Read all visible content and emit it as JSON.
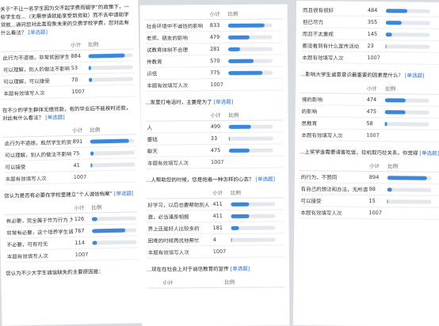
{
  "page1": {
    "sections": [
      {
        "question": "关于“不让一名学生因为交不起学费而辍学”的政策下，一些学生在...（无需申请就能享受到资助）而不去申请助学贷款...请问您对此类现象未来的交费学校学费，您对此有什么看法？",
        "tag": "[单选题]",
        "count_header": "小计",
        "ratio_header": "比例",
        "rows": [
          {
            "label": "此行为不道德，非常贫困学生享受资助，...资助不够的话需要自己的努力",
            "count": "884",
            "pct": 0.83
          },
          {
            "label": "可以理解，别人的做法不影响自己的事",
            "count": "53",
            "pct": 0.05
          },
          {
            "label": "可以理解，可以接受",
            "count": "70",
            "pct": 0.07
          }
        ],
        "total_label": "本题有效填写人次",
        "total": "1007"
      },
      {
        "question": "在不少的学生群体无偿贷款，有的毕业后不能按时还款，对此有什么看法？",
        "tag": "[单选题]",
        "count_header": "小计",
        "ratio_header": "比例",
        "rows": [
          {
            "label": "此行为不道德，既然学生的资源，要不就应该 不能让他违反",
            "count": "891",
            "pct": 0.88
          },
          {
            "label": "可以理解，别人的做法不影响自己的事",
            "count": "75",
            "pct": 0.07
          },
          {
            "label": "可以接受",
            "count": "41",
            "pct": 0.04
          }
        ],
        "total_label": "本题有效填写人次",
        "total": "1007"
      },
      {
        "question": "您认为是否有必要在学校里建立“个人诚信档案”",
        "tag": "[单选题]",
        "count_header": "小计",
        "ratio_header": "比例",
        "rows": [
          {
            "label": "有必要，完全属于作为行为 为，培养学生诚信意识的需要",
            "count": "126",
            "pct": 0.13
          },
          {
            "label": "非常有必要，这个培养学生诚信意识及其 对",
            "count": "767",
            "pct": 0.76
          },
          {
            "label": "不必要，可有可无",
            "count": "114",
            "pct": 0.11
          }
        ],
        "total_label": "本题有效填写人次",
        "total": "1007"
      }
    ],
    "bottom_question": "您认为不少大学生诚信缺失的主要原因是："
  },
  "page2": {
    "top_table": {
      "count_header": "小计",
      "ratio_header": "比例",
      "rows": [
        {
          "label": "社会环境中不诚信的影响",
          "count": "833",
          "pct": 0.83
        },
        {
          "label": "老师、朋友的影响",
          "count": "479",
          "pct": 0.48
        },
        {
          "label": "试教育体制不合理",
          "count": "281",
          "pct": 0.28
        },
        {
          "label": "传教育",
          "count": "570",
          "pct": 0.57
        },
        {
          "label": "识低",
          "count": "775",
          "pct": 0.77
        }
      ],
      "total_label": "本题有效填写人次",
      "total": "1007"
    },
    "sections": [
      {
        "question": "...家里打电话时，主要是为了",
        "tag": "[单选题]",
        "count_header": "小计",
        "ratio_header": "比例",
        "rows": [
          {
            "label": "人",
            "count": "499",
            "pct": 0.5
          },
          {
            "label": "要钱",
            "count": "33",
            "pct": 0.03
          },
          {
            "label": "聊天",
            "count": "475",
            "pct": 0.47
          }
        ],
        "total_label": "本题有效填写人次",
        "total": "1007"
      },
      {
        "question": "...人帮助您的时候，您是抱着一种怎样的心态？",
        "tag": "[单选题]",
        "count_header": "小计",
        "ratio_header": "比例",
        "rows": [
          {
            "label": "好学习，以后也要帮助别人",
            "count": "411",
            "pct": 0.41
          },
          {
            "label": "激，必当涌泉相报",
            "count": "411",
            "pct": 0.41
          },
          {
            "label": "界上还是好人比较多的",
            "count": "181",
            "pct": 0.18
          },
          {
            "label": "困难的时候再找他帮忙",
            "count": "4",
            "pct": 0.004
          }
        ],
        "total_label": "本题有效填写人次",
        "total": "1007"
      }
    ],
    "bottom_question": "...现在在社会上对于诚信教育的宣传",
    "bottom_tag": "[单选题]",
    "bottom_count_header": "小计",
    "bottom_ratio_header": "比例"
  },
  "page3": {
    "top_table": {
      "rows": [
        {
          "label": "而且很有很好",
          "count": "484",
          "pct": 0.48
        },
        {
          "label": "但已尽力",
          "count": "355",
          "pct": 0.35
        },
        {
          "label": "而且不太重视",
          "count": "145",
          "pct": 0.14
        },
        {
          "label": "都没看到有什么宣传活动",
          "count": "23",
          "pct": 0.02
        }
      ],
      "total_label": "本题有效填写人次",
      "total": "1007"
    },
    "sections": [
      {
        "question": "...影响大学生诚意意识最重要的因素是什么？",
        "tag": "[单选题]",
        "count_header": "小计",
        "ratio_header": "比例",
        "rows": [
          {
            "label": "境的影响",
            "count": "474",
            "pct": 0.47
          },
          {
            "label": "的影响",
            "count": "475",
            "pct": 0.47
          },
          {
            "label": "思教育",
            "count": "58",
            "pct": 0.06
          }
        ],
        "total_label": "本题有效填写人次",
        "total": "1007"
      },
      {
        "question": "...上奖学金需要请客吃饭，拉机取巧拉关系，你觉得",
        "tag": "[单选题]",
        "count_header": "小计",
        "ratio_header": "比例",
        "rows": [
          {
            "label": "的行为，不赞同",
            "count": "894",
            "pct": 0.89
          },
          {
            "label": "有自己的想法和办法，无所谓",
            "count": "98",
            "pct": 0.1
          },
          {
            "label": "可以接受",
            "count": "15",
            "pct": 0.015
          }
        ],
        "total_label": "本题有效填写人次",
        "total": "1007"
      }
    ]
  }
}
